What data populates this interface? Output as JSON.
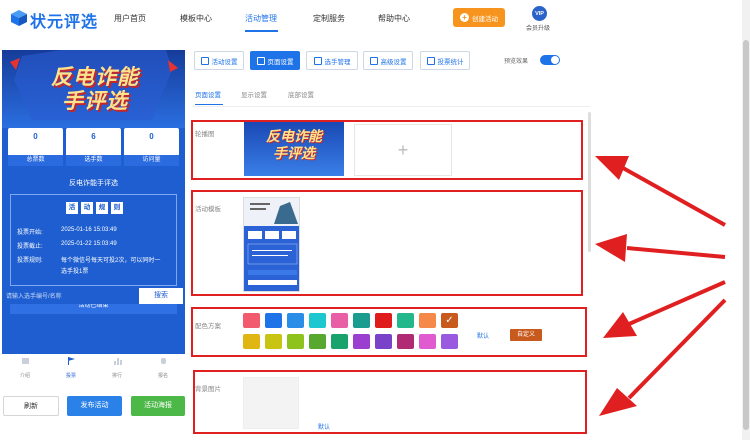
{
  "nav": {
    "logo": "状元评选",
    "items": [
      "用户首页",
      "模板中心",
      "活动管理",
      "定制服务",
      "帮助中心"
    ],
    "create_label": "创建活动",
    "vip_badge": "VIP",
    "vip_label": "会员升级"
  },
  "preview": {
    "banner_title_line1": "反电诈能",
    "banner_title_line2": "手评选",
    "stats": [
      {
        "value": "0",
        "label": "总票数"
      },
      {
        "value": "6",
        "label": "选手数"
      },
      {
        "value": "0",
        "label": "访问量"
      }
    ],
    "activity_name": "反电诈能手评选",
    "section_tags": [
      "活",
      "动",
      "规",
      "则"
    ],
    "vote_start_label": "投票开始:",
    "vote_start_value": "2025-01-16 15:03:49",
    "vote_end_label": "投票截止:",
    "vote_end_value": "2025-01-22 15:03:49",
    "vote_rule_label": "投票规则:",
    "vote_rule_value_1": "每个微信号每天可投2次，可以同时一",
    "vote_rule_value_2": "选手投1票",
    "status": "活动已结束",
    "search_placeholder": "请输入选手编号/名称",
    "search_button": "搜索",
    "tabbar": [
      "介绍",
      "投票",
      "排行",
      "报名"
    ]
  },
  "bottom_buttons": {
    "refresh": "刷新",
    "publish": "发布活动",
    "poster": "活动海报"
  },
  "toolbar": {
    "buttons": [
      "活动设置",
      "页面设置",
      "选手管理",
      "高级设置",
      "投票统计"
    ],
    "preview_effect": "预览效果"
  },
  "subtabs": [
    "页面设置",
    "显示设置",
    "底部设置"
  ],
  "settings": {
    "carousel_label": "轮播图",
    "cover_text_1": "反电诈能",
    "cover_text_2": "手评选",
    "upload_plus": "+",
    "template_label": "活动模板",
    "color_label": "配色方案",
    "color_default": "默认",
    "color_custom": "自定义",
    "bg_label": "背景图片",
    "bg_default": "默认"
  },
  "colors": {
    "accent": "#1e73e8",
    "orange": "#f7941d",
    "swatches_row1": [
      "#f25a6e",
      "#1e73e8",
      "#2a8ee8",
      "#1dc7cf",
      "#e95fa6",
      "#1a9d8f",
      "#e01b1b",
      "#22b88c",
      "#f5894a",
      "#c85a1e"
    ],
    "swatches_row2": [
      "#e0b712",
      "#c9c312",
      "#8ec31e",
      "#58a82f",
      "#17a36b",
      "#9b3fd0",
      "#7a42c8",
      "#b02a74",
      "#e05ad0",
      "#9a5ae0"
    ]
  }
}
